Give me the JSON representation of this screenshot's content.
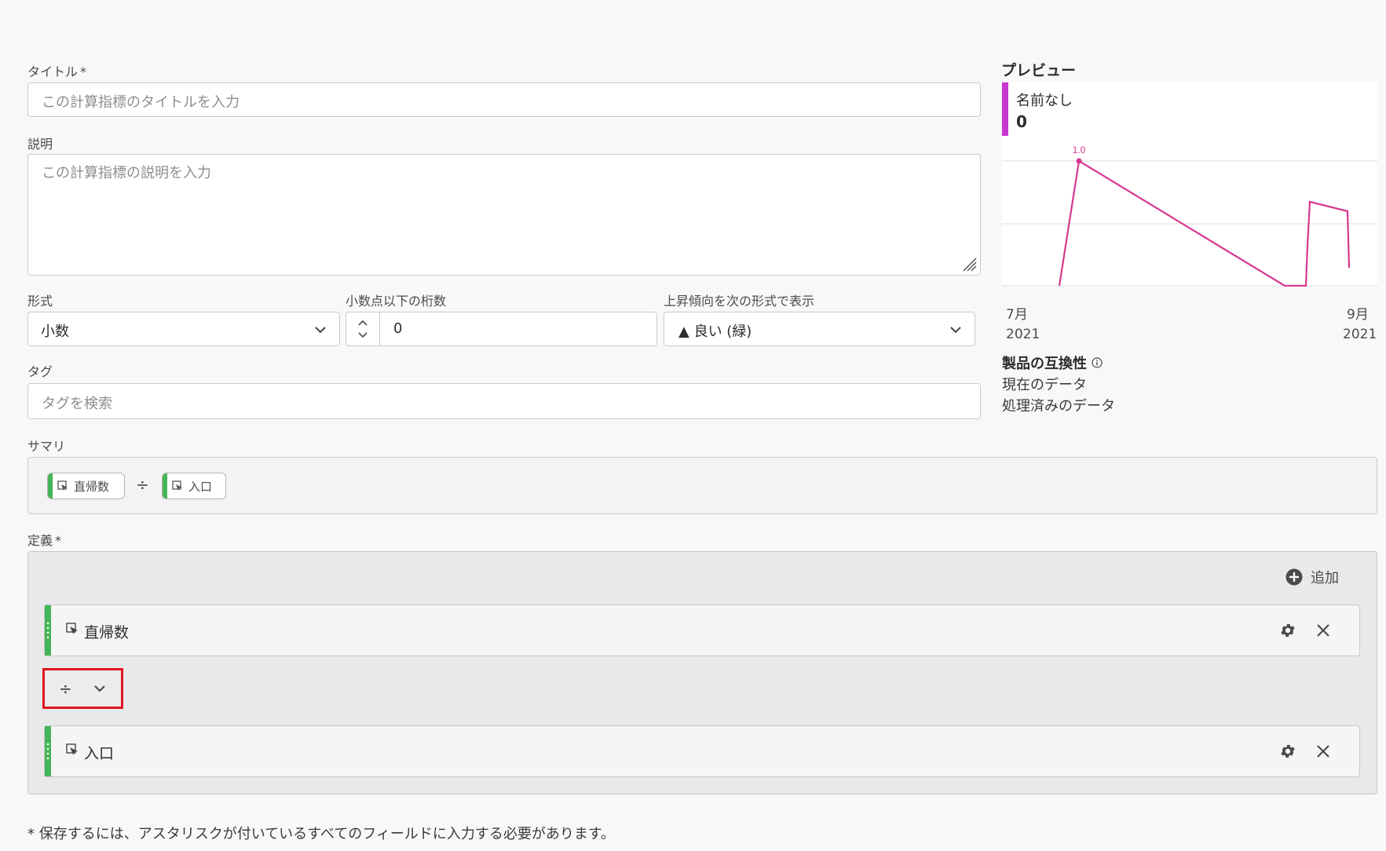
{
  "form": {
    "title_label": "タイトル",
    "required_mark": "*",
    "title_placeholder": "この計算指標のタイトルを入力",
    "description_label": "説明",
    "description_placeholder": "この計算指標の説明を入力",
    "format_label": "形式",
    "format_value": "小数",
    "decimals_label": "小数点以下の桁数",
    "decimals_value": "0",
    "trend_label": "上昇傾向を次の形式で表示",
    "trend_value": "▲ 良い (緑)",
    "tags_label": "タグ",
    "tags_placeholder": "タグを検索",
    "summary_label": "サマリ",
    "definition_label": "定義",
    "footer_note": "* 保存するには、アスタリスクが付いているすべてのフィールドに入力する必要があります。"
  },
  "summary": {
    "chips": [
      "直帰数",
      "入口"
    ],
    "operator": "÷"
  },
  "definition": {
    "add_label": "追加",
    "components": [
      {
        "name": "直帰数"
      },
      {
        "name": "入口"
      }
    ],
    "operator": "÷"
  },
  "preview": {
    "title": "プレビュー",
    "metric_name": "名前なし",
    "metric_value": "0",
    "peak_label": "1.0",
    "x_start_month": "7月",
    "x_start_year": "2021",
    "x_end_month": "9月",
    "x_end_year": "2021",
    "compat_title": "製品の互換性",
    "compat_items": [
      "現在のデータ",
      "処理済みのデータ"
    ]
  },
  "colors": {
    "accent_green": "#44b556",
    "preview_bar": "#c737d1",
    "line": "#d83790",
    "highlight_box": "#e0161e"
  }
}
